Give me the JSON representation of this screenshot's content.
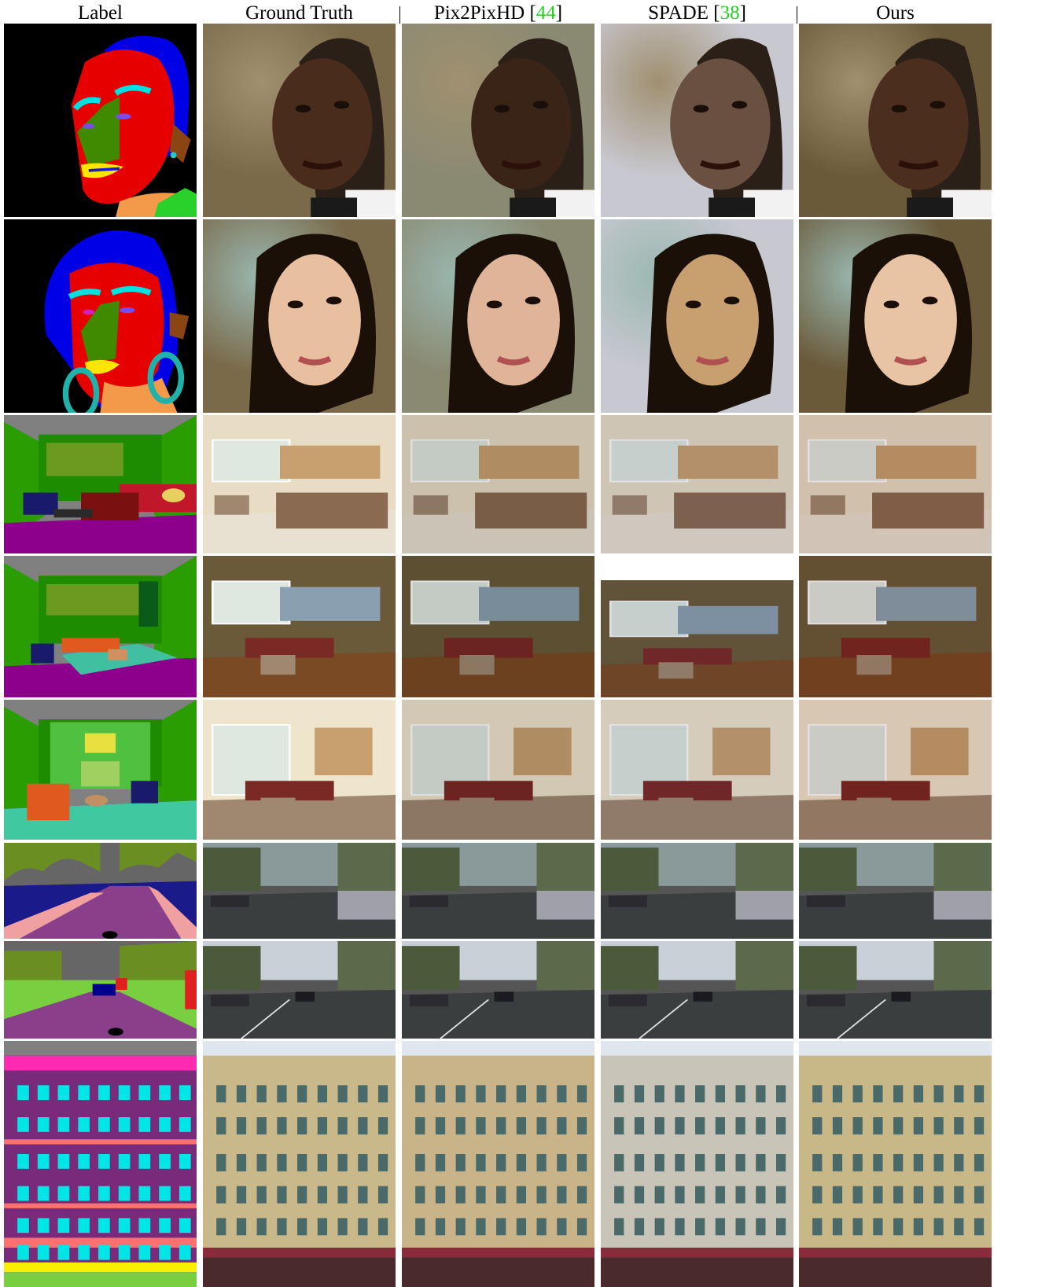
{
  "columns": [
    {
      "label": "Label",
      "cite": ""
    },
    {
      "label": "Ground Truth",
      "cite": ""
    },
    {
      "label": "Pix2PixHD [",
      "cite": "44",
      "close": "]"
    },
    {
      "label": "SPADE [",
      "cite": "38",
      "close": "]"
    },
    {
      "label": "Ours",
      "cite": ""
    }
  ],
  "rows": [
    {
      "kind": "face-man"
    },
    {
      "kind": "face-woman"
    },
    {
      "kind": "bedroom"
    },
    {
      "kind": "living-room-windows"
    },
    {
      "kind": "living-room-fireplace"
    },
    {
      "kind": "street-cars"
    },
    {
      "kind": "street-road"
    },
    {
      "kind": "building-facade"
    }
  ],
  "colors": {
    "citation": "#1fd21f",
    "face_bg": "#000000",
    "face_skin": "#e60000",
    "face_hair": "#0000e6",
    "face_nose": "#3f8a00",
    "face_brow": "#00e0e0",
    "face_lip": "#ffe600",
    "indoor_wall": "#1e8c00",
    "indoor_floor": "#8c008c",
    "street_road": "#8a3f8a",
    "street_car": "#00008c",
    "street_sky": "#666666",
    "facade_wall": "#7a2a7a",
    "facade_window": "#00e6e6"
  }
}
